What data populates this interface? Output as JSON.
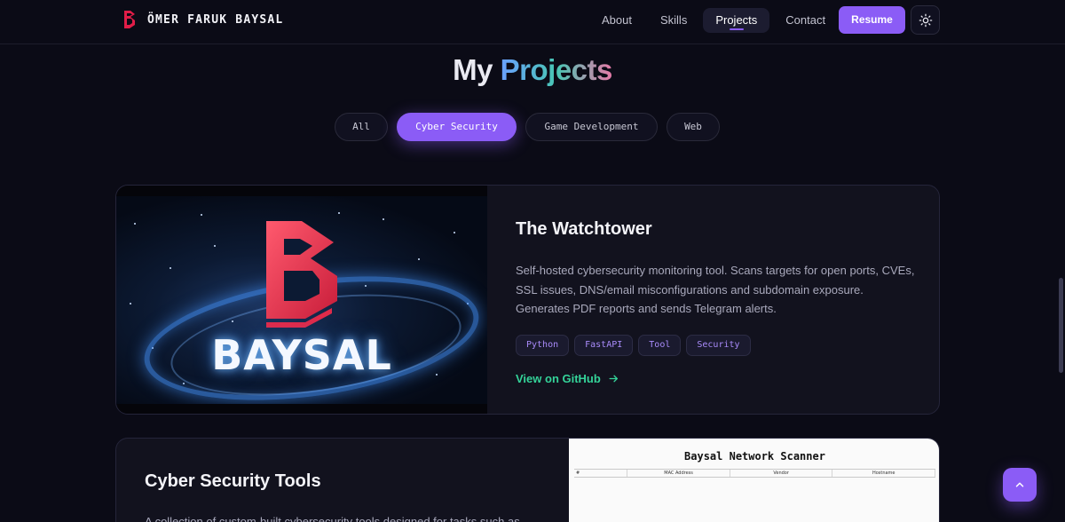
{
  "brand": {
    "name": "ÖMER FARUK BAYSAL",
    "logo_icon": "baysal-logo-icon",
    "accent": "#e11d48"
  },
  "nav": {
    "links": [
      {
        "label": "About",
        "active": false
      },
      {
        "label": "Skills",
        "active": false
      },
      {
        "label": "Projects",
        "active": true
      },
      {
        "label": "Contact",
        "active": false
      }
    ],
    "resume_label": "Resume",
    "theme_icon": "sun-icon"
  },
  "section": {
    "title_part1": "My",
    "title_part2": "Projects"
  },
  "filters": [
    {
      "label": "All",
      "active": false
    },
    {
      "label": "Cyber Security",
      "active": true
    },
    {
      "label": "Game Development",
      "active": false
    },
    {
      "label": "Web",
      "active": false
    }
  ],
  "projects": [
    {
      "image_text": "BAYSAL",
      "title": "The Watchtower",
      "description": "Self-hosted cybersecurity monitoring tool. Scans targets for open ports, CVEs, SSL issues, DNS/email misconfigurations and subdomain exposure. Generates PDF reports and sends Telegram alerts.",
      "tags": [
        "Python",
        "FastAPI",
        "Tool",
        "Security"
      ],
      "link_label": "View on GitHub"
    },
    {
      "title": "Cyber Security Tools",
      "description": "A collection of custom-built cybersecurity tools designed for tasks such as",
      "screenshot": {
        "title": "Baysal Network Scanner",
        "columns": [
          "#",
          "MAC Address",
          "Vendor",
          "Hostname"
        ]
      }
    }
  ],
  "colors": {
    "accent": "#8b5cf6",
    "link": "#34d399",
    "background": "#0b0b16"
  }
}
